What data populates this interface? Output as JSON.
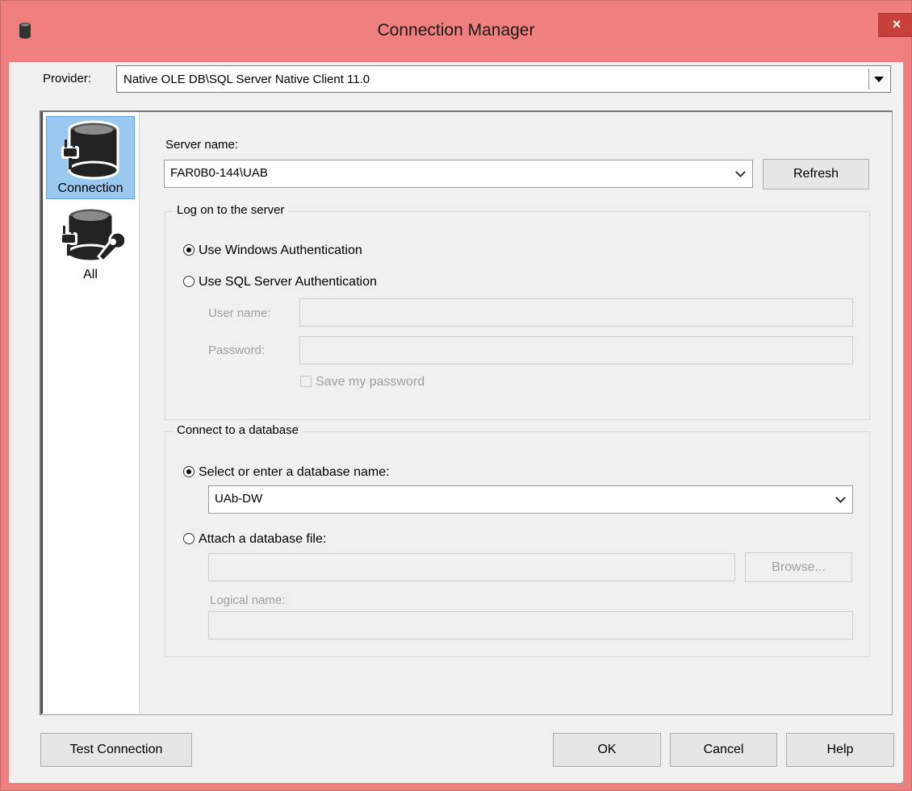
{
  "window": {
    "title": "Connection Manager",
    "close_label": "×"
  },
  "provider": {
    "label": "Provider:",
    "value": "Native OLE DB\\SQL Server Native Client 11.0"
  },
  "nav": {
    "items": [
      {
        "label": "Connection",
        "icon": "database-plug-icon",
        "selected": true
      },
      {
        "label": "All",
        "icon": "database-plug-wrench-icon",
        "selected": false
      }
    ]
  },
  "server": {
    "label": "Server name:",
    "value": "FAR0B0-144\\UAB",
    "refresh_label": "Refresh"
  },
  "logon": {
    "group_title": "Log on to the server",
    "windows_auth_label": "Use Windows Authentication",
    "sql_auth_label": "Use SQL Server Authentication",
    "selected": "windows",
    "user_label": "User name:",
    "user_value": "",
    "password_label": "Password:",
    "password_value": "",
    "save_password_label": "Save my password"
  },
  "database": {
    "group_title": "Connect to a database",
    "select_label": "Select or enter a database name:",
    "select_value": "UAb-DW",
    "attach_label": "Attach a database file:",
    "attach_value": "",
    "browse_label": "Browse...",
    "logical_label": "Logical name:",
    "logical_value": "",
    "selected": "select"
  },
  "buttons": {
    "test_label": "Test Connection",
    "ok_label": "OK",
    "cancel_label": "Cancel",
    "help_label": "Help"
  }
}
